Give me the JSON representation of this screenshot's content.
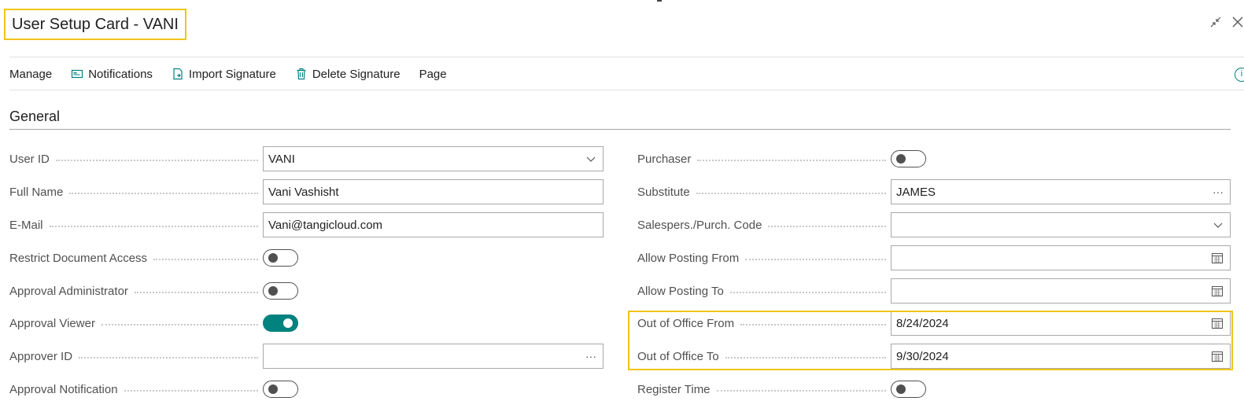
{
  "header": {
    "title": "User Setup Card - VANI"
  },
  "actions": {
    "manage": "Manage",
    "notifications": "Notifications",
    "import_signature": "Import Signature",
    "delete_signature": "Delete Signature",
    "page": "Page"
  },
  "section": {
    "title": "General"
  },
  "left": {
    "user_id": {
      "label": "User ID",
      "value": "VANI"
    },
    "full_name": {
      "label": "Full Name",
      "value": "Vani Vashisht"
    },
    "email": {
      "label": "E-Mail",
      "value": "Vani@tangicloud.com"
    },
    "restrict_doc": {
      "label": "Restrict Document Access",
      "on": false
    },
    "approval_admin": {
      "label": "Approval Administrator",
      "on": false
    },
    "approval_viewer": {
      "label": "Approval Viewer",
      "on": true
    },
    "approver_id": {
      "label": "Approver ID",
      "value": ""
    },
    "approval_notification": {
      "label": "Approval Notification",
      "on": false
    }
  },
  "right": {
    "purchaser": {
      "label": "Purchaser",
      "on": false
    },
    "substitute": {
      "label": "Substitute",
      "value": "JAMES"
    },
    "salespers_code": {
      "label": "Salespers./Purch. Code",
      "value": ""
    },
    "allow_posting_from": {
      "label": "Allow Posting From",
      "value": ""
    },
    "allow_posting_to": {
      "label": "Allow Posting To",
      "value": ""
    },
    "out_of_office_from": {
      "label": "Out of Office From",
      "value": "8/24/2024"
    },
    "out_of_office_to": {
      "label": "Out of Office To",
      "value": "9/30/2024"
    },
    "register_time": {
      "label": "Register Time",
      "on": false
    }
  },
  "colors": {
    "accent": "#00827f",
    "highlight": "#f0c419"
  }
}
